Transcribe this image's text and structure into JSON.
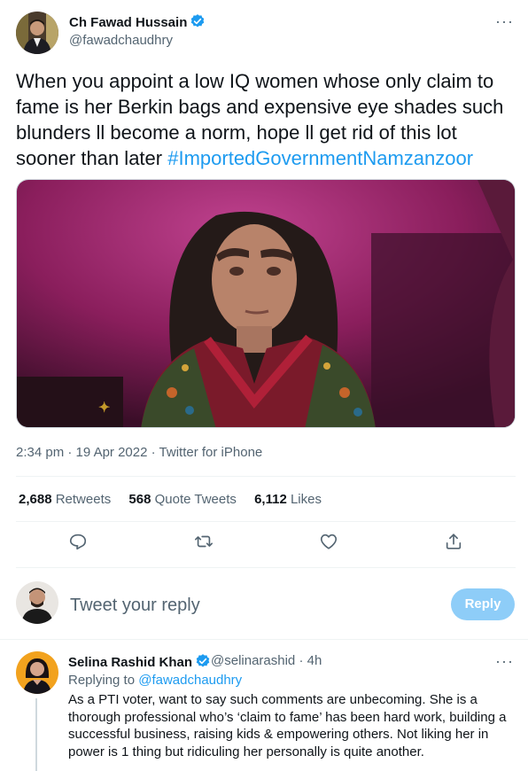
{
  "tweet": {
    "author_name": "Ch Fawad Hussain",
    "author_handle": "@fawadchaudhry",
    "more_label": "···",
    "text": "When you appoint a low IQ women whose only claim to fame is her Berkin bags and expensive eye shades such blunders ll become a norm, hope ll get rid of this lot sooner than later ",
    "hashtag": "#ImportedGovernmentNamzanzoor",
    "time": "2:34 pm",
    "date": "19 Apr 2022",
    "source": "Twitter for iPhone",
    "stats": {
      "retweets_count": "2,688",
      "retweets_label": "Retweets",
      "quotes_count": "568",
      "quotes_label": "Quote Tweets",
      "likes_count": "6,112",
      "likes_label": "Likes"
    }
  },
  "actions": {
    "icons": [
      "reply-icon",
      "retweet-icon",
      "like-icon",
      "share-icon"
    ]
  },
  "reply_composer": {
    "placeholder": "Tweet your reply",
    "button_label": "Reply"
  },
  "reply": {
    "author_name": "Selina Rashid Khan",
    "handle_time": "@selinarashid · 4h",
    "more_label": "···",
    "replying_to_label": "Replying to ",
    "replying_to_mention": "@fawadchaudhry",
    "text": "As a PTI voter, want to say such comments are unbecoming. She is a thorough professional who’s ‘claim to fame’ has been hard work, building a successful business, raising kids & empowering others. Not liking her in power is 1 thing but ridiculing her personally is quite another."
  },
  "colors": {
    "accent": "#1d9bf0",
    "reply_button_disabled": "#8ecdf8",
    "secondary_text": "#536471",
    "media_backdrop": "#8a1e5c"
  }
}
